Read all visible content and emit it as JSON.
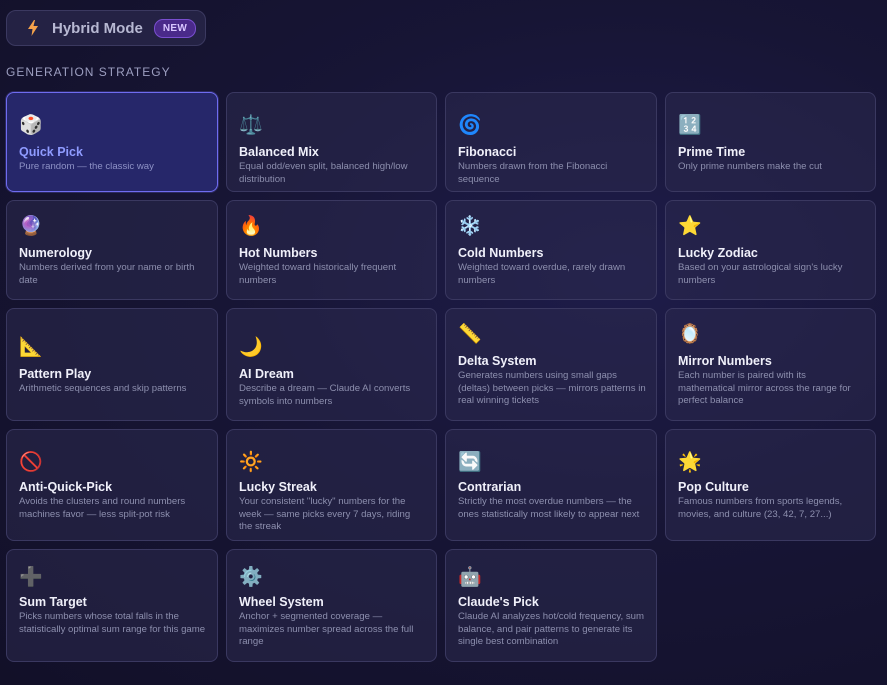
{
  "hybrid": {
    "label": "Hybrid Mode",
    "badge": "NEW"
  },
  "section_title": "GENERATION STRATEGY",
  "cards": [
    {
      "title": "Quick Pick",
      "desc": "Pure random — the classic way",
      "icon": "🎲",
      "icon_name": "dice-icon",
      "selected": true
    },
    {
      "title": "Balanced Mix",
      "desc": "Equal odd/even split, balanced high/low distribution",
      "icon": "⚖️",
      "icon_name": "scales-icon"
    },
    {
      "title": "Fibonacci",
      "desc": "Numbers drawn from the Fibonacci sequence",
      "icon": "🌀",
      "icon_name": "spiral-icon"
    },
    {
      "title": "Prime Time",
      "desc": "Only prime numbers make the cut",
      "icon": "🔢",
      "icon_name": "numbers-icon"
    },
    {
      "title": "Numerology",
      "desc": "Numbers derived from your name or birth date",
      "icon": "🔮",
      "icon_name": "crystal-ball-icon"
    },
    {
      "title": "Hot Numbers",
      "desc": "Weighted toward historically frequent numbers",
      "icon": "🔥",
      "icon_name": "fire-icon"
    },
    {
      "title": "Cold Numbers",
      "desc": "Weighted toward overdue, rarely drawn numbers",
      "icon": "❄️",
      "icon_name": "snowflake-icon"
    },
    {
      "title": "Lucky Zodiac",
      "desc": "Based on your astrological sign's lucky numbers",
      "icon": "⭐",
      "icon_name": "star-icon"
    },
    {
      "title": "Pattern Play",
      "desc": "Arithmetic sequences and skip patterns",
      "icon": "📐",
      "icon_name": "triangle-ruler-icon"
    },
    {
      "title": "AI Dream",
      "desc": "Describe a dream — Claude AI converts symbols into numbers",
      "icon": "🌙",
      "icon_name": "moon-icon"
    },
    {
      "title": "Delta System",
      "desc": "Generates numbers using small gaps (deltas) between picks — mirrors patterns in real winning tickets",
      "icon": "📏",
      "icon_name": "ruler-icon"
    },
    {
      "title": "Mirror Numbers",
      "desc": "Each number is paired with its mathematical mirror across the range for perfect balance",
      "icon": "🪞",
      "icon_name": "mirror-icon"
    },
    {
      "title": "Anti-Quick-Pick",
      "desc": "Avoids the clusters and round numbers machines favor — less split-pot risk",
      "icon": "🚫",
      "icon_name": "prohibited-icon"
    },
    {
      "title": "Lucky Streak",
      "desc": "Your consistent \"lucky\" numbers for the week — same picks every 7 days, riding the streak",
      "icon": "🔆",
      "icon_name": "sun-icon"
    },
    {
      "title": "Contrarian",
      "desc": "Strictly the most overdue numbers — the ones statistically most likely to appear next",
      "icon": "🔄",
      "icon_name": "cycle-arrows-icon"
    },
    {
      "title": "Pop Culture",
      "desc": "Famous numbers from sports legends, movies, and culture (23, 42, 7, 27...)",
      "icon": "🌟",
      "icon_name": "glowing-star-icon"
    },
    {
      "title": "Sum Target",
      "desc": "Picks numbers whose total falls in the statistically optimal sum range for this game",
      "icon": "➕",
      "icon_name": "plus-icon"
    },
    {
      "title": "Wheel System",
      "desc": "Anchor + segmented coverage — maximizes number spread across the full range",
      "icon": "⚙️",
      "icon_name": "gear-icon"
    },
    {
      "title": "Claude's Pick",
      "desc": "Claude AI analyzes hot/cold frequency, sum balance, and pair patterns to generate its single best combination",
      "icon": "🤖",
      "icon_name": "robot-icon"
    }
  ]
}
